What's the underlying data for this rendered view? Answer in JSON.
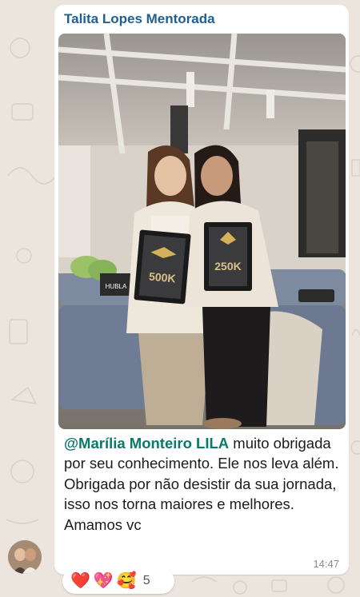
{
  "chat": {
    "sender_name": "Talita Lopes Mentorada",
    "mention": "@Marília Monteiro LILA",
    "message_text": " muito obrigada por seu conhecimento. Ele nos leva além. Obrigada por não desistir da sua jornada, isso nos torna maiores e melhores. Amamos vc",
    "time": "14:47"
  },
  "photo": {
    "plaque_left_text": "500K",
    "plaque_right_text": "250K",
    "sofa_pillow_text": "HUBLA"
  },
  "reactions": {
    "items": [
      "❤️",
      "💖",
      "🥰"
    ],
    "count": "5"
  },
  "colors": {
    "sender": "#1f5f93",
    "mention": "#0a7a68",
    "background": "#ece5dd"
  }
}
